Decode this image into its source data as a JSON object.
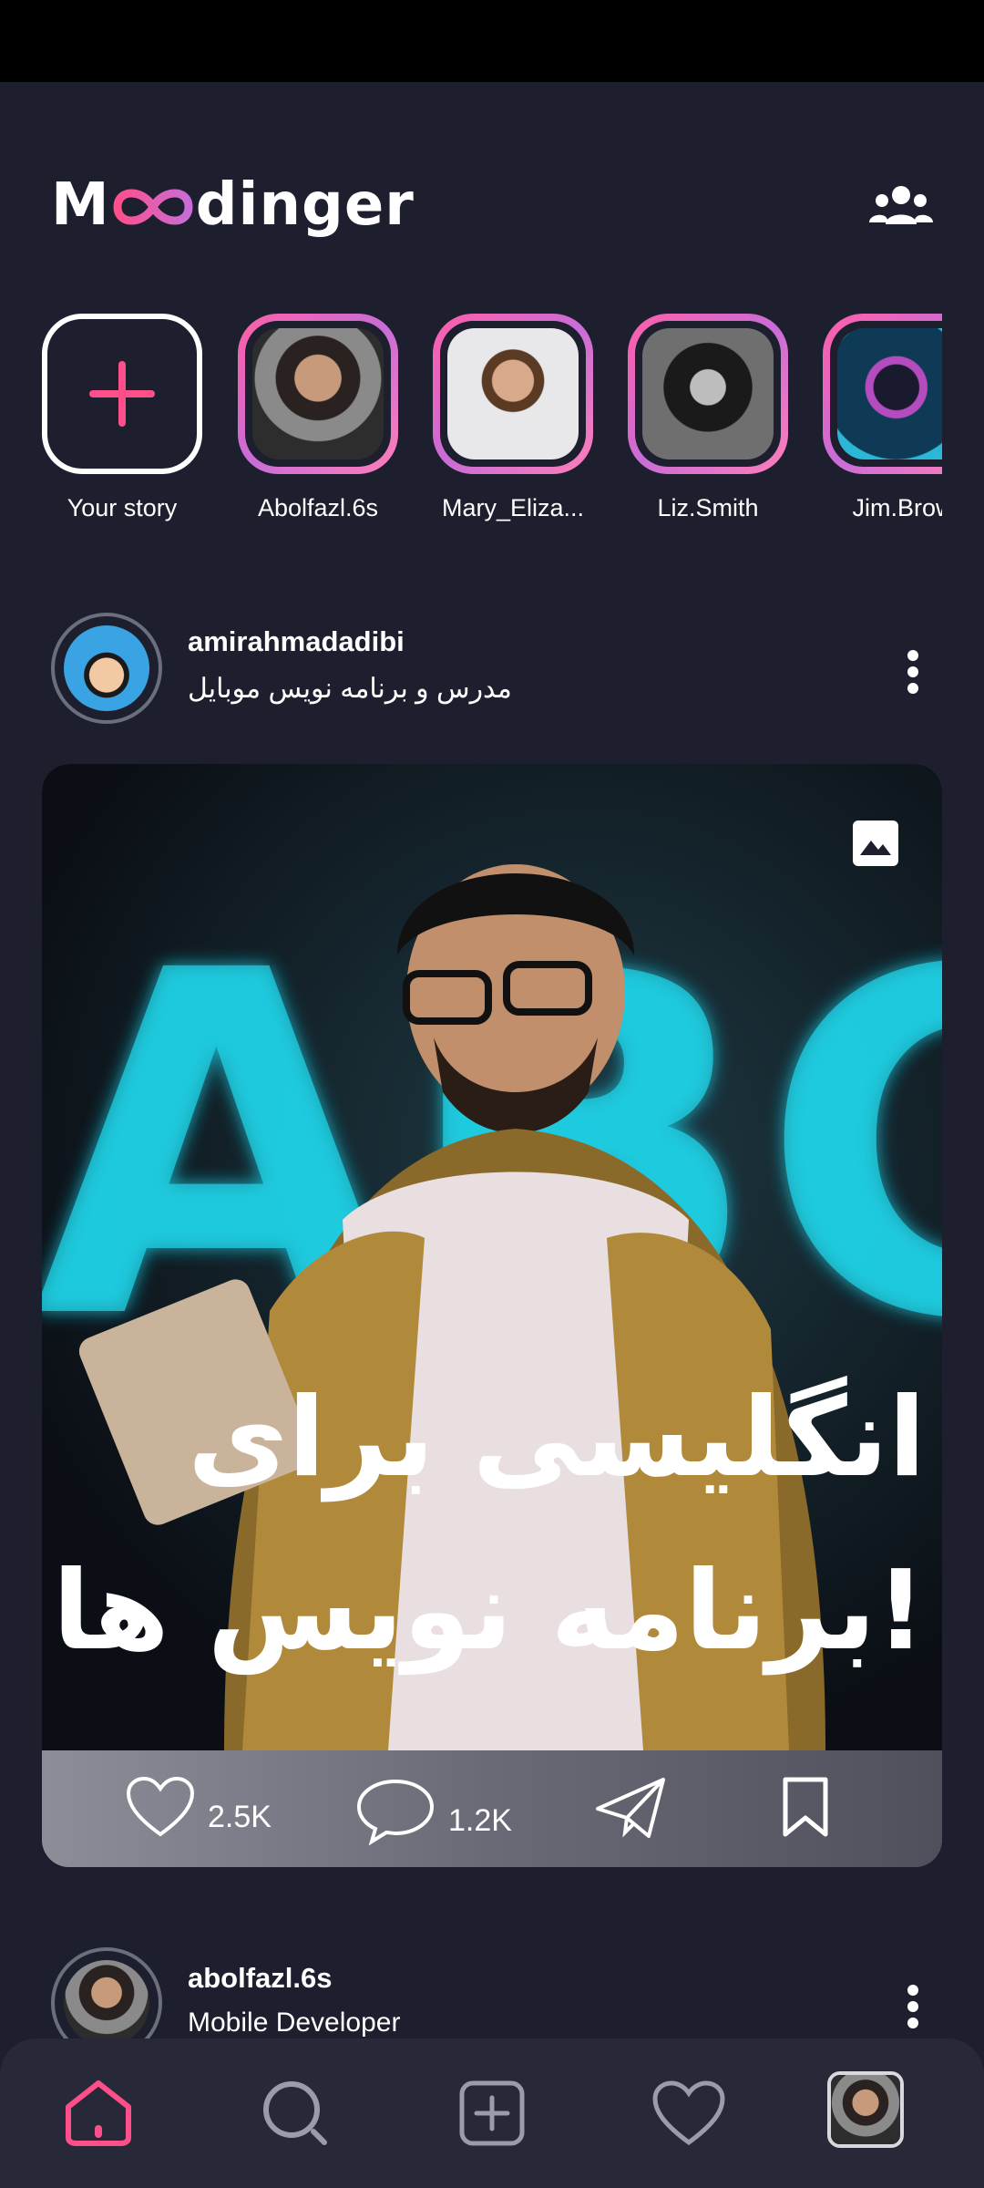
{
  "app": {
    "logo_prefix": "M",
    "logo_suffix": "dinger",
    "accent_color": "#ff4f8b",
    "background_color": "#1e1f2e"
  },
  "stories": [
    {
      "name": "Your story",
      "type": "add"
    },
    {
      "name": "Abolfazl.6s",
      "type": "user"
    },
    {
      "name": "Mary_Eliza...",
      "type": "user"
    },
    {
      "name": "Liz.Smith",
      "type": "user"
    },
    {
      "name": "Jim.Brow",
      "type": "user"
    }
  ],
  "posts": [
    {
      "username": "amirahmadadibi",
      "bio": "مدرس و برنامه نویس موبایل",
      "image_caption_line1": "انگلیسی برای",
      "image_caption_line2": "برنامه نویس ها!",
      "image_bg_letters": "ABC",
      "likes": "2.5K",
      "comments": "1.2K"
    },
    {
      "username": "abolfazl.6s",
      "bio": "Mobile Developer"
    }
  ],
  "nav": [
    "home-icon",
    "search-icon",
    "add-post-icon",
    "heart-icon",
    "profile-avatar"
  ]
}
